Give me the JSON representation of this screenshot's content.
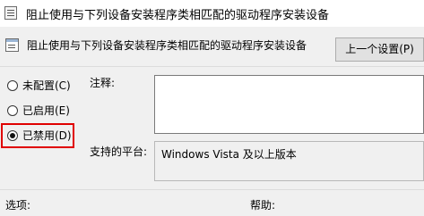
{
  "window": {
    "title": "阻止使用与下列设备安装程序类相匹配的驱动程序安装设备"
  },
  "header": {
    "policy_name": "阻止使用与下列设备安装程序类相匹配的驱动程序安装设备"
  },
  "toolbar": {
    "prev_setting_label": "上一个设置(P)"
  },
  "options": {
    "items": [
      {
        "label": "未配置(C)",
        "selected": false
      },
      {
        "label": "已启用(E)",
        "selected": false
      },
      {
        "label": "已禁用(D)",
        "selected": true
      }
    ]
  },
  "comment": {
    "label": "注释:",
    "value": ""
  },
  "platform": {
    "label": "支持的平台:",
    "value": "Windows Vista 及以上版本"
  },
  "footer": {
    "options_label": "选项:",
    "help_label": "帮助:"
  },
  "colors": {
    "highlight": "#e00000",
    "background": "#f0f0f0"
  }
}
